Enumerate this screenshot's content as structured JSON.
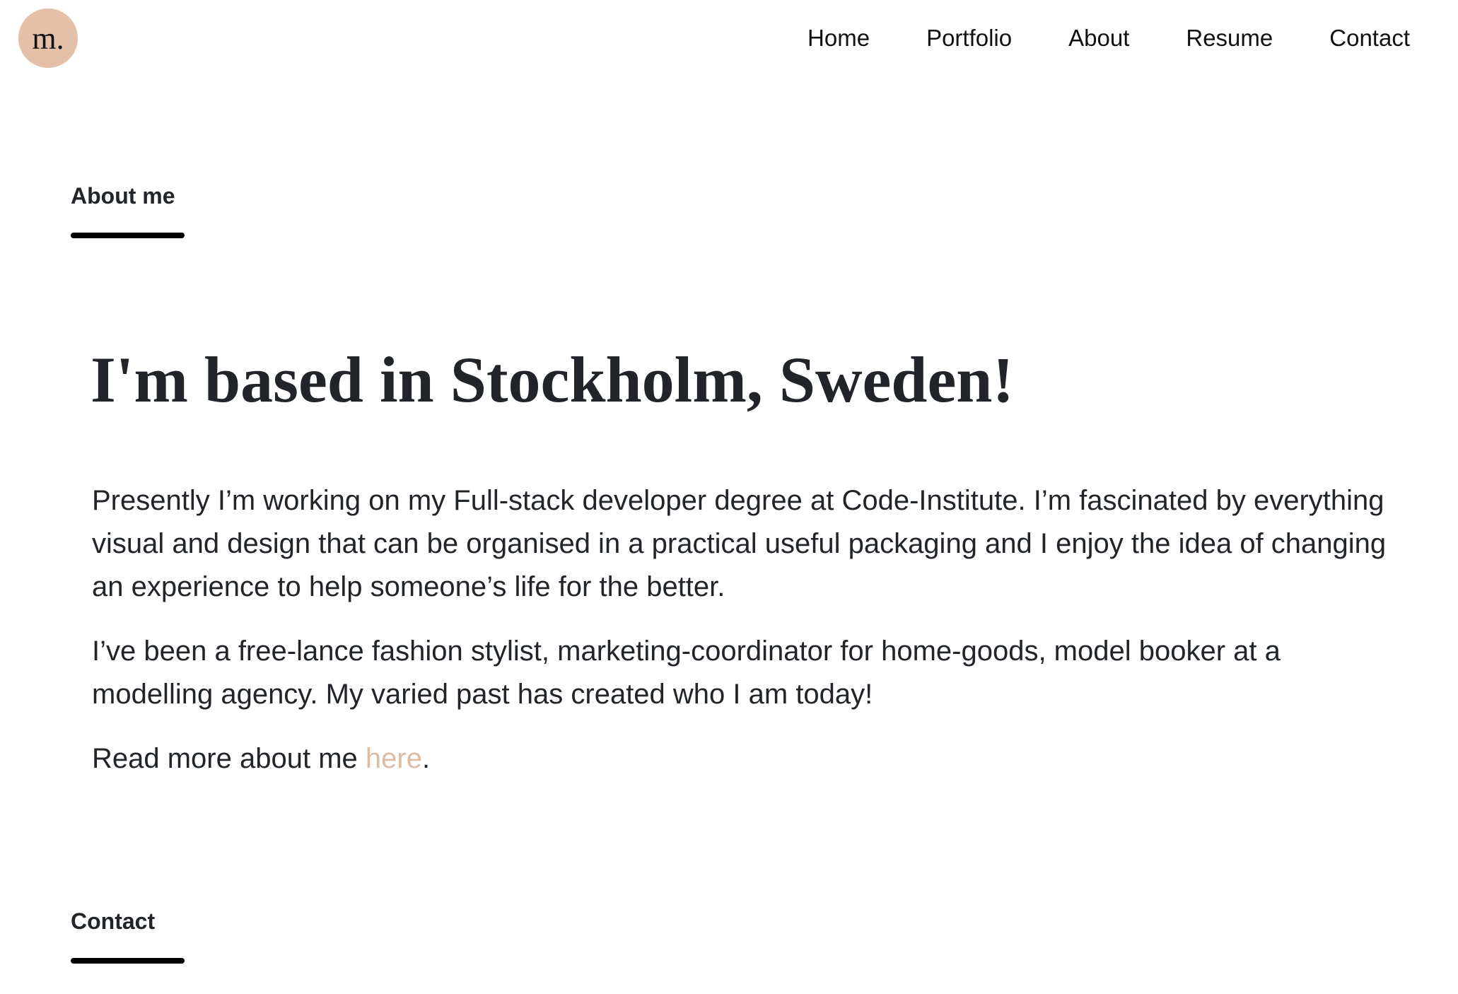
{
  "header": {
    "logo_text": "m.",
    "nav": [
      {
        "label": "Home"
      },
      {
        "label": "Portfolio"
      },
      {
        "label": "About"
      },
      {
        "label": "Resume"
      },
      {
        "label": "Contact"
      }
    ]
  },
  "about_section": {
    "label": "About me",
    "headline": "I'm based in Stockholm, Sweden!",
    "paragraphs": [
      "Presently I’m working on my Full-stack developer degree at Code-Institute. I’m fascinated by everything visual and design that can be organised in a practical useful packaging and I enjoy the idea of changing an experience to help someone’s life for the better.",
      "I’ve been a free-lance fashion stylist, marketing-coordinator for home-goods, model booker at a modelling agency. My varied past has created who I am today!"
    ],
    "read_more_prefix": "Read more about me ",
    "read_more_link": "here",
    "read_more_suffix": "."
  },
  "contact_section": {
    "label": "Contact"
  },
  "colors": {
    "accent": "#e3c0a7",
    "link": "#dcbca4",
    "text": "#212529",
    "bar": "#000000"
  }
}
